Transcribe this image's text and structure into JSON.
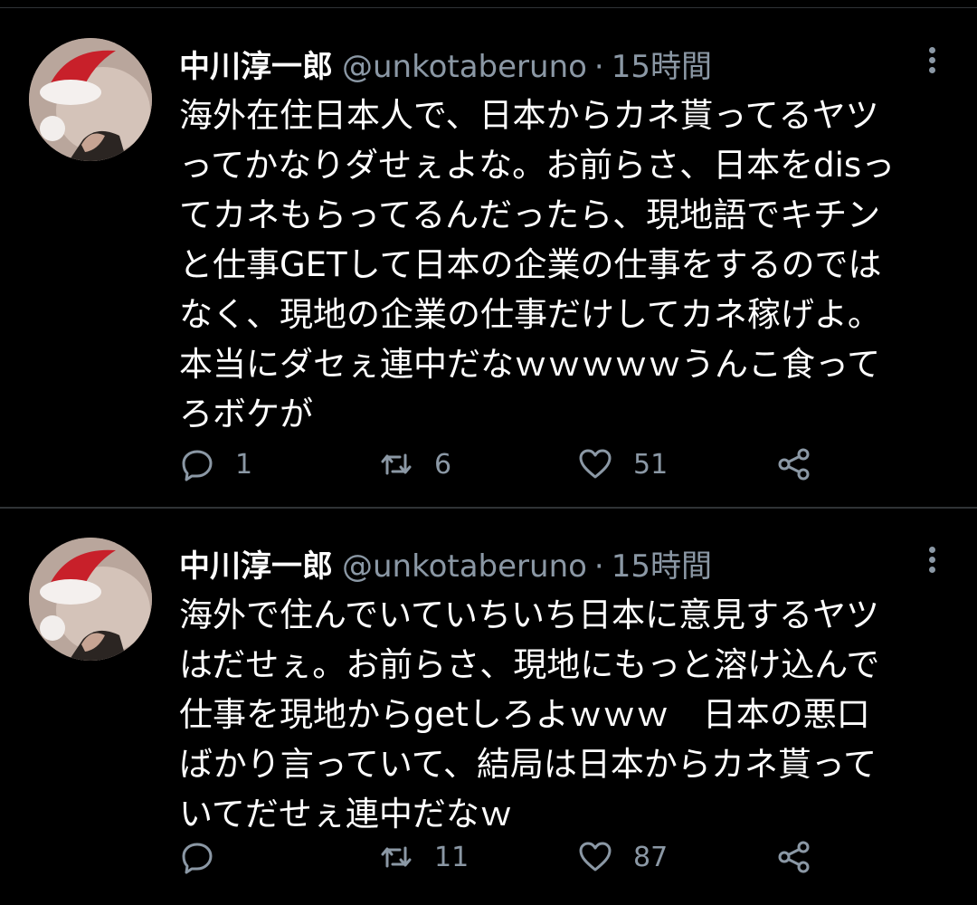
{
  "tweets": [
    {
      "author_name": "中川淳一郎",
      "handle": "@unkotaberuno",
      "separator": "·",
      "time": "15時間",
      "text_lines": [
        "海外在住日本人で、日本からカネ貰ってるヤツ",
        "ってかなりダせぇよな。お前らさ、日本をdisっ",
        "てカネもらってるんだったら、現地語でキチン",
        "と仕事GETして日本の企業の仕事をするのでは",
        "なく、現地の企業の仕事だけしてカネ稼げよ。",
        "本当にダセぇ連中だなｗｗｗｗｗうんこ食って",
        "ろボケが"
      ],
      "reply_count": "1",
      "retweet_count": "6",
      "like_count": "51"
    },
    {
      "author_name": "中川淳一郎",
      "handle": "@unkotaberuno",
      "separator": "·",
      "time": "15時間",
      "text_lines": [
        "海外で住んでいていちいち日本に意見するヤツ",
        "はだせぇ。お前らさ、現地にもっと溶け込んで",
        "仕事を現地からgetしろよｗｗｗ　日本の悪口",
        "ばかり言っていて、結局は日本からカネ貰って",
        "いてだせぇ連中だなｗ"
      ],
      "reply_count": "",
      "retweet_count": "11",
      "like_count": "87"
    }
  ],
  "icons": {
    "reply": "reply-icon",
    "retweet": "retweet-icon",
    "like": "heart-icon",
    "share": "share-icon",
    "more": "more-vertical-icon"
  },
  "colors": {
    "background": "#000000",
    "text": "#ffffff",
    "secondary": "#8b98a5",
    "divider": "#2f3336"
  }
}
